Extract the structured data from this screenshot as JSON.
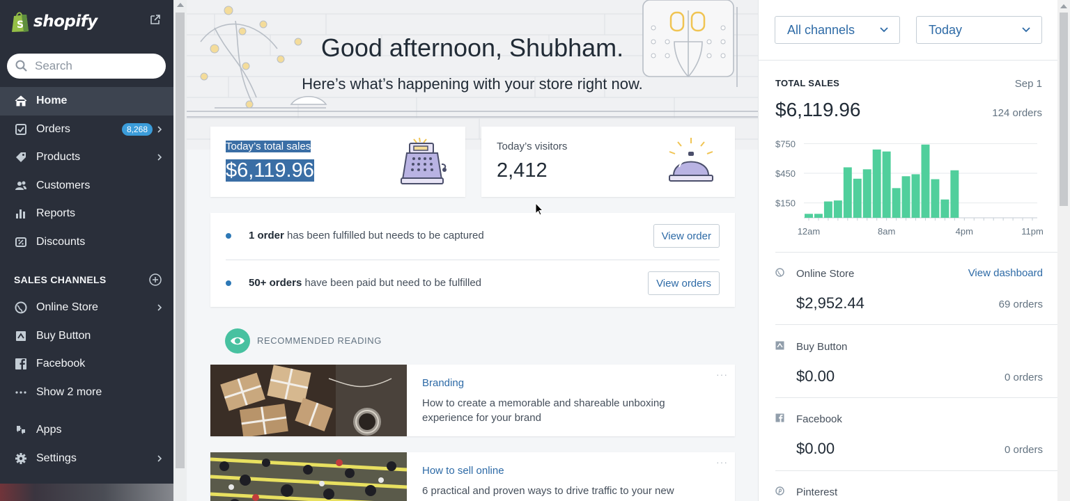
{
  "brand": {
    "name": "shopify"
  },
  "search": {
    "placeholder": "Search"
  },
  "nav": {
    "items": [
      {
        "label": "Home",
        "icon": "home-icon",
        "active": true
      },
      {
        "label": "Orders",
        "icon": "orders-icon",
        "badge": "8,268"
      },
      {
        "label": "Products",
        "icon": "tag-icon"
      },
      {
        "label": "Customers",
        "icon": "customers-icon"
      },
      {
        "label": "Reports",
        "icon": "reports-icon"
      },
      {
        "label": "Discounts",
        "icon": "discounts-icon"
      }
    ],
    "sales_channels_heading": "SALES CHANNELS",
    "channels": [
      {
        "label": "Online Store",
        "icon": "globe-icon"
      },
      {
        "label": "Buy Button",
        "icon": "buy-button-icon"
      },
      {
        "label": "Facebook",
        "icon": "facebook-icon"
      },
      {
        "label": "Show 2 more",
        "icon": "more-icon"
      }
    ],
    "bottom": [
      {
        "label": "Apps",
        "icon": "apps-icon"
      },
      {
        "label": "Settings",
        "icon": "gear-icon"
      }
    ]
  },
  "hero": {
    "greeting": "Good afternoon, Shubham.",
    "subtitle": "Here’s what’s happening with your store right now."
  },
  "kpis": {
    "sales_label": "Today’s total sales",
    "sales_value": "$6,119.96",
    "visitors_label": "Today’s visitors",
    "visitors_value": "2,412"
  },
  "tasks": [
    {
      "bold": "1 order",
      "text": " has been fulfilled but needs to be captured",
      "button": "View order"
    },
    {
      "bold": "50+ orders",
      "text": " have been paid but need to be fulfilled",
      "button": "View orders"
    }
  ],
  "recommended": {
    "heading": "RECOMMENDED READING",
    "articles": [
      {
        "category": "Branding",
        "description": "How to create a memorable and shareable unboxing experience for your brand",
        "more": "···"
      },
      {
        "category": "How to sell online",
        "description": "6 practical and proven ways to drive traffic to your new online",
        "more": "···"
      }
    ]
  },
  "filters": {
    "channel": "All channels",
    "period": "Today"
  },
  "total_sales": {
    "label": "TOTAL SALES",
    "date": "Sep 1",
    "value": "$6,119.96",
    "orders": "124 orders"
  },
  "chart_data": {
    "type": "bar",
    "ylabels": [
      "$750",
      "$450",
      "$150"
    ],
    "xlabels": [
      "12am",
      "8am",
      "4pm",
      "11pm"
    ],
    "categories": [
      "0",
      "1",
      "2",
      "3",
      "4",
      "5",
      "6",
      "7",
      "8",
      "9",
      "10",
      "11",
      "12",
      "13",
      "14",
      "15",
      "16",
      "17",
      "18",
      "19",
      "20",
      "21",
      "22",
      "23"
    ],
    "values": [
      40,
      40,
      165,
      175,
      510,
      395,
      490,
      690,
      670,
      300,
      420,
      440,
      740,
      390,
      185,
      480,
      0,
      0,
      0,
      0,
      0,
      0,
      0,
      0
    ],
    "ylim": [
      0,
      900
    ],
    "color": "#50cf9c"
  },
  "channels": [
    {
      "name": "Online Store",
      "link": "View dashboard",
      "value": "$2,952.44",
      "orders": "69 orders",
      "icon": "globe-icon"
    },
    {
      "name": "Buy Button",
      "value": "$0.00",
      "orders": "0 orders",
      "icon": "buy-button-icon"
    },
    {
      "name": "Facebook",
      "value": "$0.00",
      "orders": "0 orders",
      "icon": "facebook-icon"
    },
    {
      "name": "Pinterest",
      "icon": "pinterest-icon"
    }
  ],
  "colors": {
    "sidebar": "#2a2f3a",
    "accent": "#2d6aa6",
    "bar": "#50cf9c",
    "badge": "#3b9cd9"
  }
}
